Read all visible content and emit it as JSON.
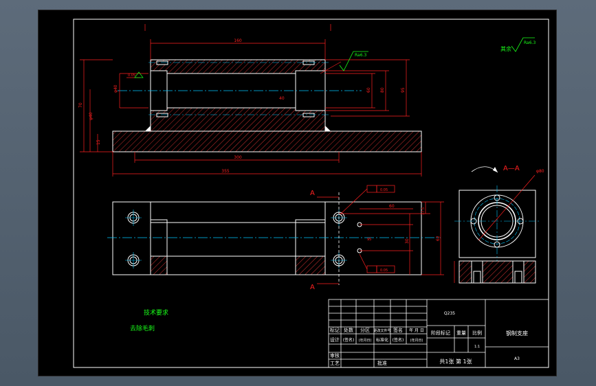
{
  "colors": {
    "background": "#000000",
    "outline": "#ffffff",
    "dimension": "#ff2020",
    "centerline": "#00c8ff",
    "hatch": "#ff4040",
    "note": "#19ff19"
  },
  "dimensions": {
    "top_length": "160",
    "base_length": "300",
    "overall_length": "355",
    "side_height_left": "70",
    "side_height_2": "φ40",
    "side_height_3": "15",
    "bore_left": "φ40",
    "bore_mid": "40",
    "right_a": "60",
    "right_b": "80",
    "right_c": "95",
    "plan_top": "60",
    "plan_right_a": "17.5",
    "plan_right_b": "30",
    "plan_right_c": "62",
    "plan_mid": "95",
    "plan_low": "60"
  },
  "labels": {
    "section_mark_top": "A",
    "section_mark_bottom": "A",
    "section_view": "A—A",
    "roughness_top": "Ra6.3",
    "roughness_corner_prefix": "其余",
    "roughness_corner": "Ra6.3",
    "tol_1": "0.05",
    "tol_2": "0.05",
    "view_dim": "φ80",
    "left_tol": "0.05"
  },
  "notes": {
    "title": "技术要求",
    "line1": "去除毛刺"
  },
  "title_block": {
    "material": "Q235",
    "part_name": "钢制支座",
    "drawing_no": "A3",
    "header_cells": [
      "标记",
      "处数",
      "分区",
      "更改文件号",
      "签名",
      "年 月 日"
    ],
    "row2_cells": [
      "设计",
      "(签名)",
      "(年月日)",
      "标准化",
      "(签名)",
      "(年月日)"
    ],
    "stage_labels": [
      "阶段标记",
      "重量",
      "比例"
    ],
    "scale": "1:1",
    "review": "审核",
    "process": "工艺",
    "approve": "批准",
    "sheet": "共1张 第 1张"
  }
}
